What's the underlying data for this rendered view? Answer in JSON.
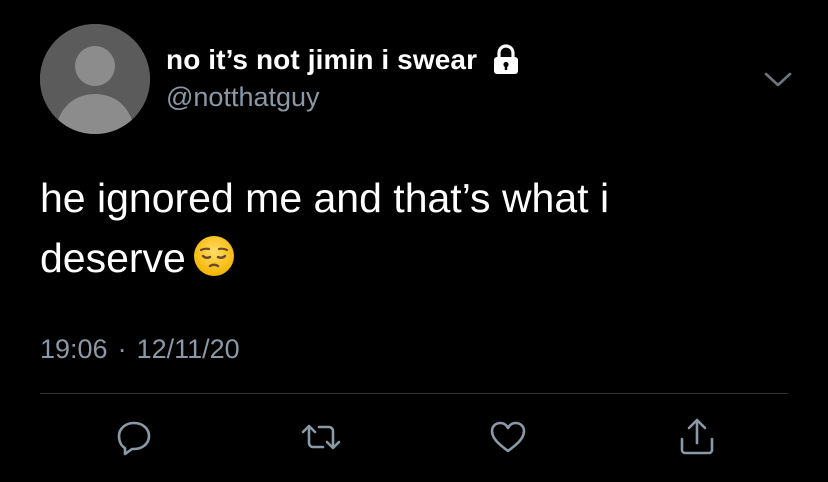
{
  "tweet": {
    "author": {
      "display_name": "no it’s not jimin i swear",
      "handle": "@notthatguy",
      "protected_icon": "lock-icon"
    },
    "text_line1": "he ignored me and that’s what i",
    "text_line2": "deserve",
    "emoji": "pensive-face",
    "time": "19:06",
    "separator": "·",
    "date": "12/11/20"
  },
  "actions": {
    "reply_icon": "reply-icon",
    "retweet_icon": "retweet-icon",
    "like_icon": "heart-icon",
    "share_icon": "share-icon"
  },
  "colors": {
    "background": "#000000",
    "text": "#ffffff",
    "secondary": "#8b98a5",
    "divider": "#2f3336",
    "avatar_bg": "#5b5b5b",
    "avatar_fg": "#8c8c8c"
  }
}
